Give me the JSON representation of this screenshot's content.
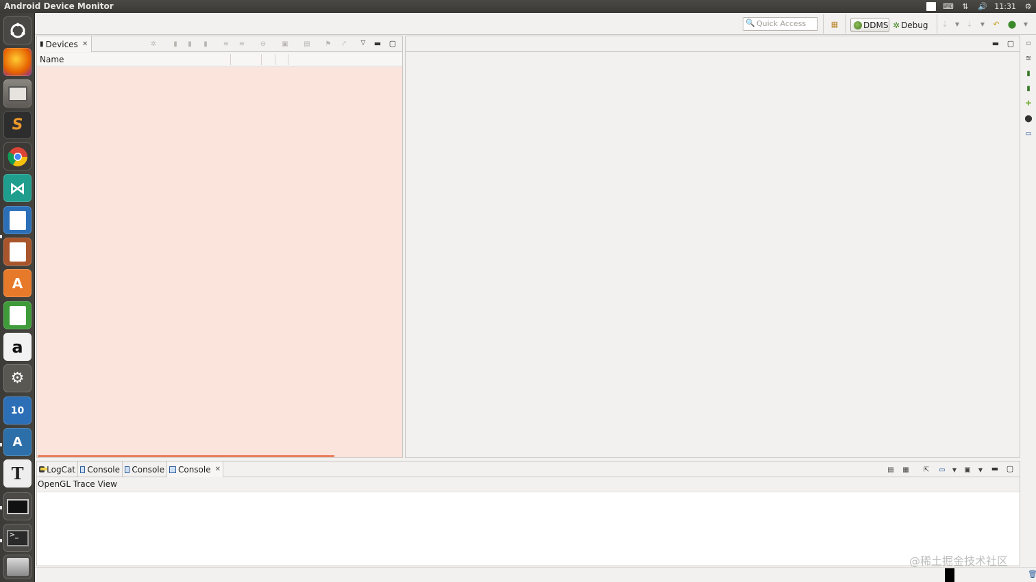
{
  "window": {
    "title": "Android Device Monitor",
    "clock": "11:31"
  },
  "toolbar": {
    "quick_access_placeholder": "Quick Access",
    "perspectives": [
      {
        "label": "DDMS",
        "active": true
      },
      {
        "label": "Debug",
        "active": false
      }
    ]
  },
  "devices_view": {
    "tab_label": "Devices",
    "column_name": "Name"
  },
  "console_view": {
    "tabs": [
      {
        "label": "LogCat",
        "icon": "logcat-icon"
      },
      {
        "label": "Console",
        "icon": "console-icon"
      },
      {
        "label": "Console",
        "icon": "console-icon"
      },
      {
        "label": "Console",
        "icon": "console-icon",
        "active": true
      }
    ],
    "subtitle": "OpenGL Trace View"
  },
  "launcher": {
    "apps": [
      "dash",
      "firefox",
      "files",
      "sublime-text",
      "chrome",
      "visual-studio",
      "writer",
      "impress",
      "software-center",
      "calc",
      "amazon",
      "system-settings",
      "drive-x10",
      "android-studio",
      "typora",
      "screen",
      "terminal",
      "disks"
    ]
  },
  "watermark": "@稀土掘金技术社区",
  "colors": {
    "device_list_bg": "#fbe4dc",
    "accent_orange": "#e6643c",
    "titlebar_bg": "#3c3b37"
  }
}
